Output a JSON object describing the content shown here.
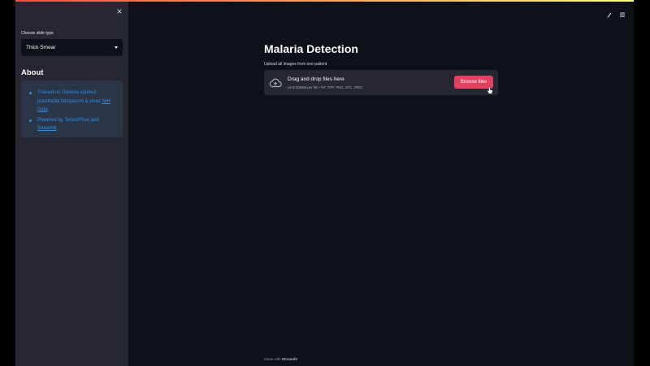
{
  "sidebar": {
    "close_glyph": "×",
    "select_label": "Choose slide type",
    "select_value": "Thick Smear",
    "about_title": "About",
    "about_items": [
      {
        "text_before": "Trained on Giemsa stained plasmodia falciparum & vivax ",
        "link": "NIH Data"
      },
      {
        "text_before": "Powered by TensorFlow and ",
        "link": "Streamlit"
      }
    ]
  },
  "header": {
    "edit_icon": "edit-icon",
    "menu_icon": "hamburger-menu-icon"
  },
  "main": {
    "title": "Malaria Detection",
    "upload_label": "Upload all images from one patient",
    "dropzone_title": "Drag and drop files here",
    "dropzone_limit": "Limit 200MB per file • TIF, TIFF, PNG, JPG, JPEG",
    "browse_label": "Browse files"
  },
  "footer": {
    "prefix": "Made with ",
    "brand": "Streamlit"
  },
  "colors": {
    "background": "#0e1117",
    "sidebar": "#262730",
    "accent": "#e1415f",
    "link": "#2f90e5",
    "about_box": "#2a3548"
  }
}
